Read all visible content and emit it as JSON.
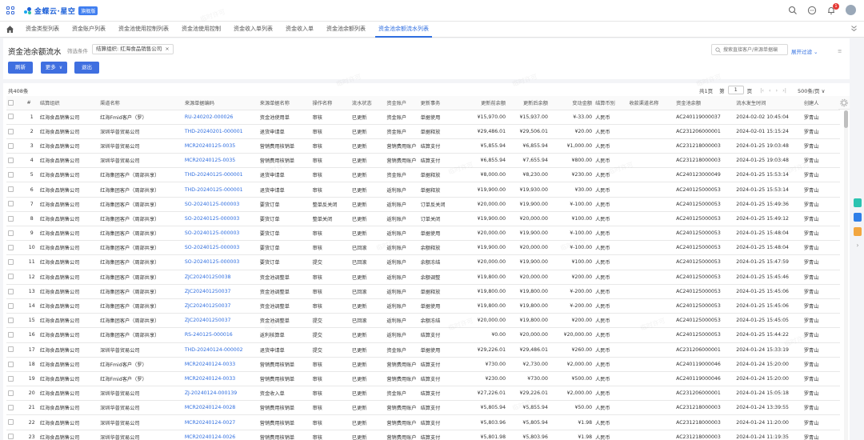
{
  "header": {
    "app_name": "金蝶云·星空",
    "edition_badge": "旗舰版",
    "notification_count": "1",
    "colors": {
      "brand": "#1f62d9",
      "accent": "#2f6ee0"
    }
  },
  "tabs": [
    {
      "label": "资金类型列表",
      "active": false
    },
    {
      "label": "资金账户列表",
      "active": false
    },
    {
      "label": "资金池使用控制列表",
      "active": false
    },
    {
      "label": "资金池使用控制",
      "active": false
    },
    {
      "label": "资金收入单列表",
      "active": false
    },
    {
      "label": "资金收入单",
      "active": false
    },
    {
      "label": "资金池余额列表",
      "active": false
    },
    {
      "label": "资金池余额流水列表",
      "active": true
    }
  ],
  "page": {
    "title": "资金池余额流水",
    "filter_label": "筛选条件",
    "filter_chip": "结算组织: 红海食品销售公司",
    "search_placeholder": "搜索直接客户/来源单据编",
    "expand_filter": "展开过滤",
    "buttons": {
      "refresh": "刷新",
      "more": "更多",
      "exit": "退出"
    }
  },
  "pager": {
    "total": "共408条",
    "pages": "共1页",
    "page_prefix": "第",
    "page_value": "1",
    "page_suffix": "页",
    "page_size": "500条/页"
  },
  "columns": [
    "#",
    "结算组织",
    "渠道名称",
    "来源单据编码",
    "来源单据名称",
    "操作名称",
    "流水状态",
    "资金账户",
    "更新事务",
    "更新前余额",
    "更新后余额",
    "变动金额",
    "结算币别",
    "收款渠道名称",
    "资金池余额",
    "流水发生时间",
    "创建人"
  ],
  "rows": [
    [
      "1",
      "红海食品销售公司",
      "红海Fmid客户（罗）",
      "RU-240202-000026",
      "资金池使用单",
      "审核",
      "已更新",
      "资金账户",
      "单据使用",
      "¥15,970.00",
      "¥15,937.00",
      "¥-33.00",
      "人民币",
      "",
      "AC240119000037",
      "2024-02-02 10:45:04",
      "罗青山"
    ],
    [
      "2",
      "红海食品销售公司",
      "深圳华普贸易公司",
      "THD-20240201-000001",
      "退货申请单",
      "审核",
      "已更新",
      "资金账户",
      "单据释放",
      "¥29,486.01",
      "¥29,506.01",
      "¥20.00",
      "人民币",
      "",
      "AC231206000001",
      "2024-02-01 15:15:24",
      "罗青山"
    ],
    [
      "3",
      "红海食品销售公司",
      "深圳华普贸易公司",
      "MCR20240125-0035",
      "营销费用核销单",
      "审核",
      "已更新",
      "营销费用账户",
      "结算支付",
      "¥5,855.94",
      "¥6,855.94",
      "¥1,000.00",
      "人民币",
      "",
      "AC231218000003",
      "2024-01-25 19:03:48",
      "罗青山"
    ],
    [
      "4",
      "红海食品销售公司",
      "深圳华普贸易公司",
      "MCR20240125-0035",
      "营销费用核销单",
      "审核",
      "已更新",
      "营销费用账户",
      "结算支付",
      "¥6,855.94",
      "¥7,655.94",
      "¥800.00",
      "人民币",
      "",
      "AC231218000003",
      "2024-01-25 19:03:48",
      "罗青山"
    ],
    [
      "5",
      "红海食品销售公司",
      "红海集团客户（周部共享）",
      "THD-20240125-000001",
      "退货申请单",
      "审核",
      "已更新",
      "资金账户",
      "单据释放",
      "¥8,000.00",
      "¥8,230.00",
      "¥230.00",
      "人民币",
      "",
      "AC240123000049",
      "2024-01-25 15:53:14",
      "罗青山"
    ],
    [
      "6",
      "红海食品销售公司",
      "红海集团客户（周部共享）",
      "THD-20240125-000001",
      "退货申请单",
      "审核",
      "已更新",
      "返利账户",
      "单据释放",
      "¥19,900.00",
      "¥19,930.00",
      "¥30.00",
      "人民币",
      "",
      "AC240125000053",
      "2024-01-25 15:53:14",
      "罗青山"
    ],
    [
      "7",
      "红海食品销售公司",
      "红海集团客户（周部共享）",
      "SO-20240125-000003",
      "要货订单",
      "整单反关闭",
      "已更新",
      "返利账户",
      "订单反关闭",
      "¥20,000.00",
      "¥19,900.00",
      "¥-100.00",
      "人民币",
      "",
      "AC240125000053",
      "2024-01-25 15:49:36",
      "罗青山"
    ],
    [
      "8",
      "红海食品销售公司",
      "红海集团客户（周部共享）",
      "SO-20240125-000003",
      "要货订单",
      "整单关闭",
      "已更新",
      "返利账户",
      "订单关闭",
      "¥19,900.00",
      "¥20,000.00",
      "¥100.00",
      "人民币",
      "",
      "AC240125000053",
      "2024-01-25 15:49:12",
      "罗青山"
    ],
    [
      "9",
      "红海食品销售公司",
      "红海集团客户（周部共享）",
      "SO-20240125-000003",
      "要货订单",
      "审核",
      "已更新",
      "返利账户",
      "单据使用",
      "¥20,000.00",
      "¥19,900.00",
      "¥-100.00",
      "人民币",
      "",
      "AC240125000053",
      "2024-01-25 15:48:04",
      "罗青山"
    ],
    [
      "10",
      "红海食品销售公司",
      "红海集团客户（周部共享）",
      "SO-20240125-000003",
      "要货订单",
      "审核",
      "已回滚",
      "返利账户",
      "余额释放",
      "¥19,900.00",
      "¥20,000.00",
      "¥-100.00",
      "人民币",
      "",
      "AC240125000053",
      "2024-01-25 15:48:04",
      "罗青山"
    ],
    [
      "11",
      "红海食品销售公司",
      "红海集团客户（周部共享）",
      "SO-20240125-000003",
      "要货订单",
      "提交",
      "已回滚",
      "返利账户",
      "余额冻结",
      "¥20,000.00",
      "¥19,900.00",
      "¥100.00",
      "人民币",
      "",
      "AC240125000053",
      "2024-01-25 15:47:59",
      "罗青山"
    ],
    [
      "12",
      "红海食品销售公司",
      "红海集团客户（周部共享）",
      "ZJC202401250038",
      "资金池调整单",
      "审核",
      "已更新",
      "返利账户",
      "余额调整",
      "¥19,800.00",
      "¥20,000.00",
      "¥200.00",
      "人民币",
      "",
      "AC240125000053",
      "2024-01-25 15:45:46",
      "罗青山"
    ],
    [
      "13",
      "红海食品销售公司",
      "红海集团客户（周部共享）",
      "ZJC202401250037",
      "资金池调整单",
      "审核",
      "已回滚",
      "返利账户",
      "单据释放",
      "¥19,800.00",
      "¥19,800.00",
      "¥-200.00",
      "人民币",
      "",
      "AC240125000053",
      "2024-01-25 15:45:06",
      "罗青山"
    ],
    [
      "14",
      "红海食品销售公司",
      "红海集团客户（周部共享）",
      "ZJC202401250037",
      "资金池调整单",
      "审核",
      "已更新",
      "返利账户",
      "单据使用",
      "¥19,800.00",
      "¥19,800.00",
      "¥-200.00",
      "人民币",
      "",
      "AC240125000053",
      "2024-01-25 15:45:06",
      "罗青山"
    ],
    [
      "15",
      "红海食品销售公司",
      "红海集团客户（周部共享）",
      "ZJC202401250037",
      "资金池调整单",
      "提交",
      "已回滚",
      "返利账户",
      "余额冻结",
      "¥20,000.00",
      "¥19,800.00",
      "¥200.00",
      "人民币",
      "",
      "AC240125000053",
      "2024-01-25 15:45:05",
      "罗青山"
    ],
    [
      "16",
      "红海食品销售公司",
      "红海集团客户（周部共享）",
      "RS-240125-000016",
      "返利核算单",
      "提交",
      "已更新",
      "返利账户",
      "结算支付",
      "¥0.00",
      "¥20,000.00",
      "¥20,000.00",
      "人民币",
      "",
      "AC240125000053",
      "2024-01-25 15:44:22",
      "罗青山"
    ],
    [
      "17",
      "红海食品销售公司",
      "深圳华普贸易公司",
      "THD-20240124-000002",
      "退货申请单",
      "提交",
      "已更新",
      "资金账户",
      "单据使用",
      "¥29,226.01",
      "¥29,486.01",
      "¥260.00",
      "人民币",
      "",
      "AC231206000001",
      "2024-01-24 15:33:19",
      "罗青山"
    ],
    [
      "18",
      "红海食品销售公司",
      "红海Fmid客户（罗）",
      "MCR20240124-0033",
      "营销费用核销单",
      "审核",
      "已更新",
      "营销费用账户",
      "结算支付",
      "¥730.00",
      "¥2,730.00",
      "¥2,000.00",
      "人民币",
      "",
      "AC240119000046",
      "2024-01-24 15:20:00",
      "罗青山"
    ],
    [
      "19",
      "红海食品销售公司",
      "红海Fmid客户（罗）",
      "MCR20240124-0033",
      "营销费用核销单",
      "审核",
      "已更新",
      "营销费用账户",
      "结算支付",
      "¥230.00",
      "¥730.00",
      "¥500.00",
      "人民币",
      "",
      "AC240119000046",
      "2024-01-24 15:20:00",
      "罗青山"
    ],
    [
      "20",
      "红海食品销售公司",
      "深圳华普贸易公司",
      "ZJ-20240124-000139",
      "资金收入单",
      "审核",
      "已更新",
      "资金账户",
      "结算支付",
      "¥27,226.01",
      "¥29,226.01",
      "¥2,000.00",
      "人民币",
      "",
      "AC231206000001",
      "2024-01-24 15:05:18",
      "罗青山"
    ],
    [
      "21",
      "红海食品销售公司",
      "深圳华普贸易公司",
      "MCR20240124-0028",
      "营销费用核销单",
      "审核",
      "已更新",
      "营销费用账户",
      "结算支付",
      "¥5,805.94",
      "¥5,855.94",
      "¥50.00",
      "人民币",
      "",
      "AC231218000003",
      "2024-01-24 13:39:55",
      "罗青山"
    ],
    [
      "22",
      "红海食品销售公司",
      "深圳华普贸易公司",
      "MCR20240124-0027",
      "营销费用核销单",
      "审核",
      "已更新",
      "营销费用账户",
      "结算支付",
      "¥5,803.96",
      "¥5,805.94",
      "¥1.98",
      "人民币",
      "",
      "AC231218000003",
      "2024-01-24 11:20:00",
      "罗青山"
    ],
    [
      "23",
      "红海食品销售公司",
      "深圳华普贸易公司",
      "MCR20240124-0026",
      "营销费用核销单",
      "审核",
      "已更新",
      "营销费用账户",
      "结算支付",
      "¥5,801.98",
      "¥5,803.96",
      "¥1.98",
      "人民币",
      "",
      "AC231218000003",
      "2024-01-24 11:19:35",
      "罗青山"
    ]
  ],
  "watermark": "临时许可"
}
